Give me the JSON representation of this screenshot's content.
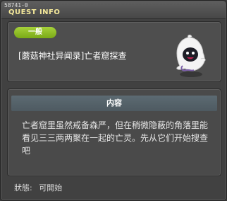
{
  "window": {
    "quest_id": "58741-0",
    "title": "QUEST INFO"
  },
  "quest": {
    "category_badge": "一般",
    "name": "[蘑菇神社异闻录]亡者窟探查",
    "icon": "ghost-monster-icon"
  },
  "content": {
    "header": "内容",
    "description": "亡者窟里虽然戒备森严，但在稍微隐蔽的角落里能看见三三两两聚在一起的亡灵。先从它们开始搜查吧"
  },
  "status": {
    "label": "狀態:",
    "value": "可開始"
  },
  "colors": {
    "badge": "#8fbf25",
    "title": "#f4e89a",
    "background": "#414141"
  }
}
